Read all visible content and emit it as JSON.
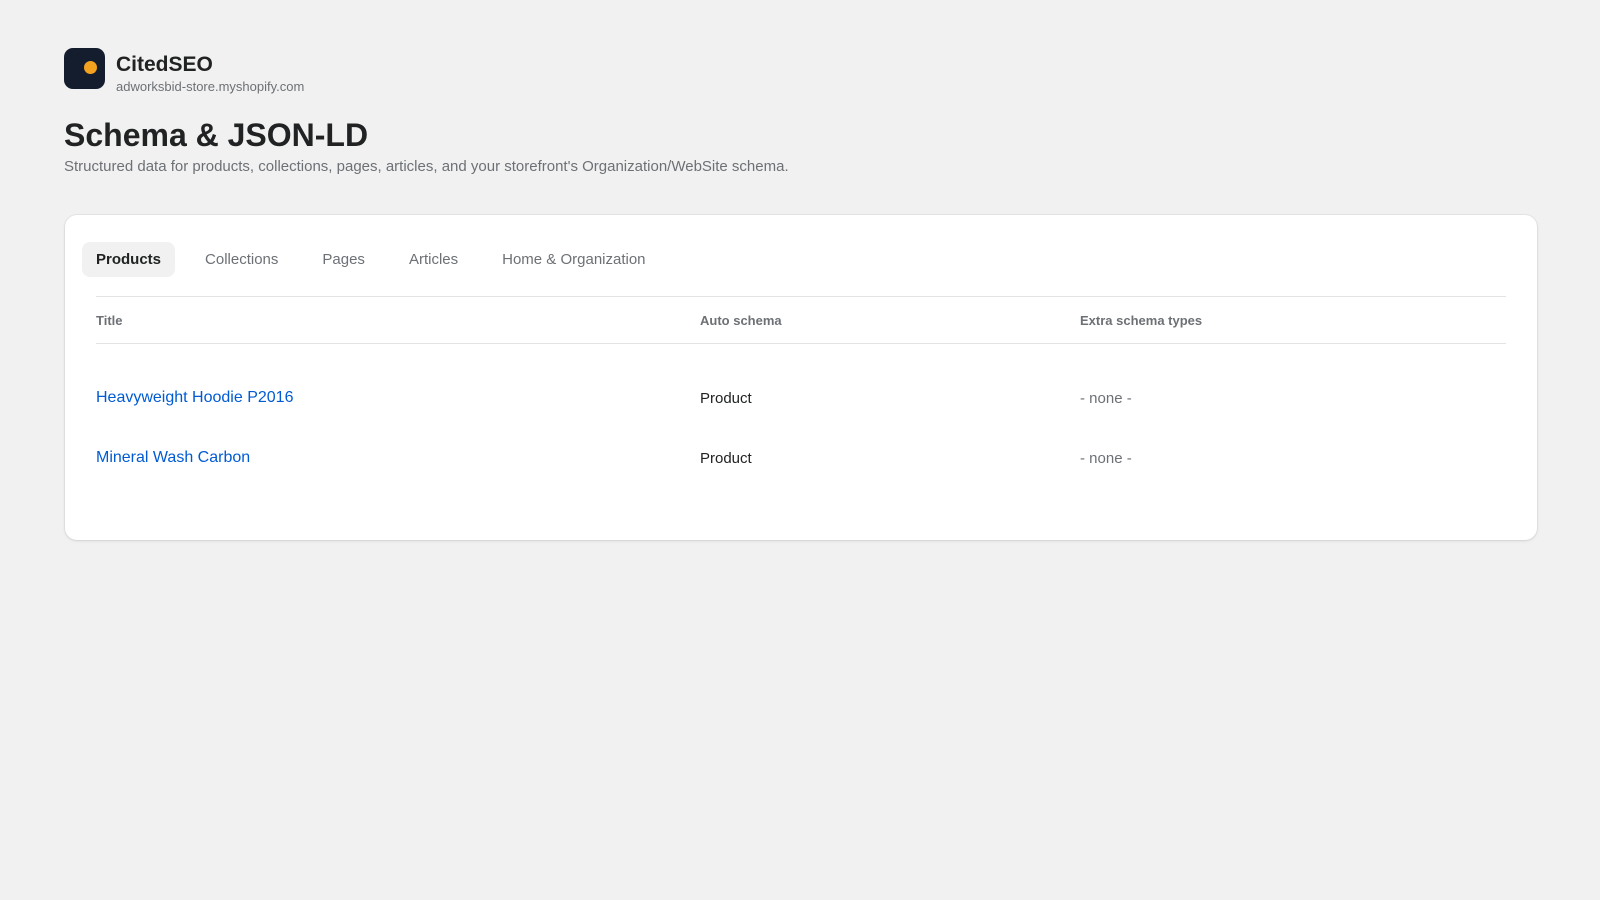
{
  "brand": {
    "name": "CitedSEO",
    "domain": "adworksbid-store.myshopify.com",
    "logo_bg": "#141d2e",
    "logo_dot": "#f2a21e"
  },
  "page": {
    "title": "Schema & JSON-LD",
    "subtitle": "Structured data for products, collections, pages, articles, and your storefront's Organization/WebSite schema."
  },
  "tabs": [
    {
      "label": "Products",
      "active": true
    },
    {
      "label": "Collections",
      "active": false
    },
    {
      "label": "Pages",
      "active": false
    },
    {
      "label": "Articles",
      "active": false
    },
    {
      "label": "Home & Organization",
      "active": false
    }
  ],
  "table": {
    "headers": {
      "title": "Title",
      "auto_schema": "Auto schema",
      "extra_schema": "Extra schema types"
    },
    "rows": [
      {
        "title": "Heavyweight Hoodie P2016",
        "auto_schema": "Product",
        "extra_schema": "- none -"
      },
      {
        "title": "Mineral Wash Carbon",
        "auto_schema": "Product",
        "extra_schema": "- none -"
      }
    ]
  },
  "colors": {
    "background": "#f1f1f1",
    "link": "#005bd3",
    "text": "#202223",
    "muted": "#6d7175"
  }
}
